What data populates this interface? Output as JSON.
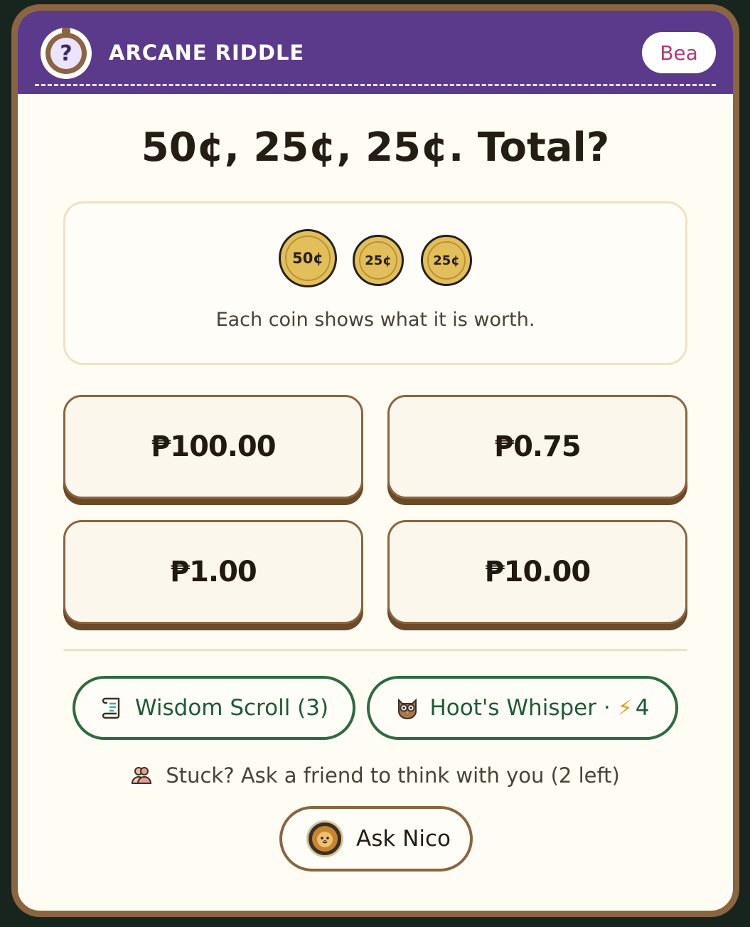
{
  "header": {
    "title": "ARCANE RIDDLE",
    "user_name": "Bea",
    "badge_glyph": "?",
    "color": "#5b3a8c"
  },
  "question": {
    "text": "50¢, 25¢, 25¢. Total?"
  },
  "coin_panel": {
    "coins": [
      "50¢",
      "25¢",
      "25¢"
    ],
    "hint": "Each coin shows what it is worth."
  },
  "answers": [
    {
      "label": "₱100.00"
    },
    {
      "label": "₱0.75"
    },
    {
      "label": "₱1.00"
    },
    {
      "label": "₱10.00"
    }
  ],
  "tools": {
    "scroll": {
      "label": "Wisdom Scroll (3)",
      "icon": "scroll-icon"
    },
    "whisper": {
      "label": "Hoot's Whisper ·",
      "cost": "4",
      "icon": "owl-icon",
      "cost_icon": "lightning-icon"
    }
  },
  "friend": {
    "prompt": "Stuck? Ask a friend to think with you (2 left)",
    "prompt_icon": "friends-icon",
    "button_label": "Ask Nico",
    "avatar_icon": "lion-avatar-icon"
  },
  "colors": {
    "accent_green": "#2e6b42",
    "frame_brown": "#8a6540",
    "coin_gold": "#e2bf5a",
    "user_pink": "#b23a72"
  }
}
